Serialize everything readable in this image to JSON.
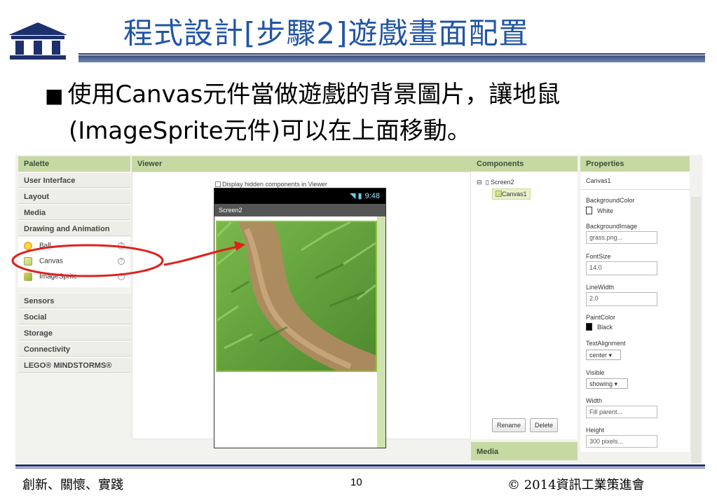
{
  "slide": {
    "title": "程式設計[步驟2]遊戲畫面配置",
    "bullet_line1": "使用Canvas元件當做遊戲的背景圖片，讓地鼠",
    "bullet_line2": "(ImageSprite元件)可以在上面移動。",
    "bullet_marker": "■"
  },
  "palette": {
    "header": "Palette",
    "categories_top": [
      "User Interface",
      "Layout",
      "Media",
      "Drawing and Animation"
    ],
    "items": [
      {
        "label": "Ball",
        "icon": "ball-icon"
      },
      {
        "label": "Canvas",
        "icon": "canvas-icon"
      },
      {
        "label": "ImageSprite",
        "icon": "imagesprite-icon"
      }
    ],
    "categories_bottom": [
      "Sensors",
      "Social",
      "Storage",
      "Connectivity",
      "LEGO® MINDSTORMS®"
    ]
  },
  "viewer": {
    "header": "Viewer",
    "hidden_checkbox_label": "Display hidden components in Viewer",
    "status_time": "9:48",
    "screen_title": "Screen2"
  },
  "components": {
    "header": "Components",
    "root": "Screen2",
    "child": "Canvas1",
    "rename_label": "Rename",
    "delete_label": "Delete",
    "media_header": "Media"
  },
  "properties": {
    "header": "Properties",
    "component_name": "Canvas1",
    "background_color_label": "BackgroundColor",
    "background_color_value": "White",
    "background_image_label": "BackgroundImage",
    "background_image_value": "grass.png...",
    "font_size_label": "FontSize",
    "font_size_value": "14.0",
    "line_width_label": "LineWidth",
    "line_width_value": "2.0",
    "paint_color_label": "PaintColor",
    "paint_color_value": "Black",
    "text_alignment_label": "TextAlignment",
    "text_alignment_value": "center",
    "visible_label": "Visible",
    "visible_value": "showing",
    "width_label": "Width",
    "width_value": "Fill parent...",
    "height_label": "Height",
    "height_value": "300 pixels..."
  },
  "footer": {
    "left": "創新、關懷、實踐",
    "page_number": "10",
    "right": "© 2014資訊工業策進會"
  },
  "colors": {
    "title_blue": "#2155a6",
    "header_green": "#c7d9a3",
    "annotation_red": "#e0201c"
  }
}
